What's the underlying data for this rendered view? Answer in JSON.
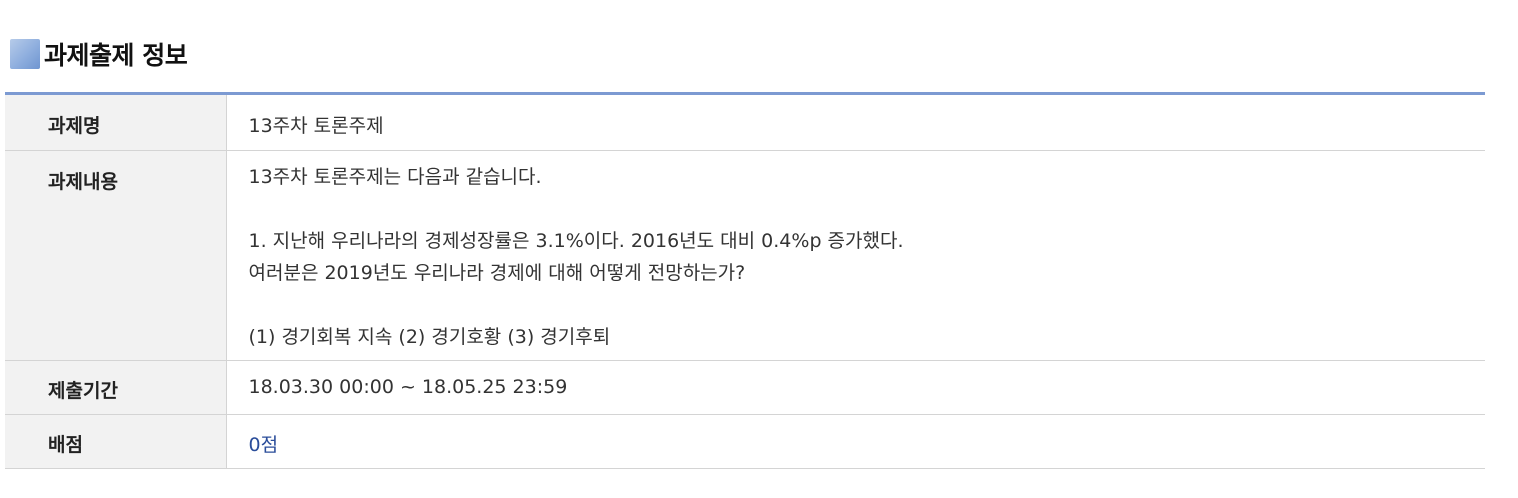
{
  "section": {
    "title": "과제출제 정보"
  },
  "table": {
    "rows": [
      {
        "label": "과제명",
        "value": "13주차 토론주제"
      },
      {
        "label": "과제내용",
        "lines": [
          "13주차 토론주제는 다음과 같습니다.",
          "",
          "1. 지난해 우리나라의 경제성장률은 3.1%이다. 2016년도 대비 0.4%p 증가했다.",
          "여러분은 2019년도 우리나라 경제에 대해 어떻게 전망하는가?",
          "",
          "(1) 경기회복 지속 (2) 경기호황 (3) 경기후퇴"
        ]
      },
      {
        "label": "제출기간",
        "value": "18.03.30 00:00 ~ 18.05.25 23:59"
      },
      {
        "label": "배점",
        "value": "0점"
      }
    ]
  },
  "colors": {
    "header_border": "#7c9ad2",
    "label_bg": "#f2f2f2",
    "score_text": "#2a4d9a"
  }
}
